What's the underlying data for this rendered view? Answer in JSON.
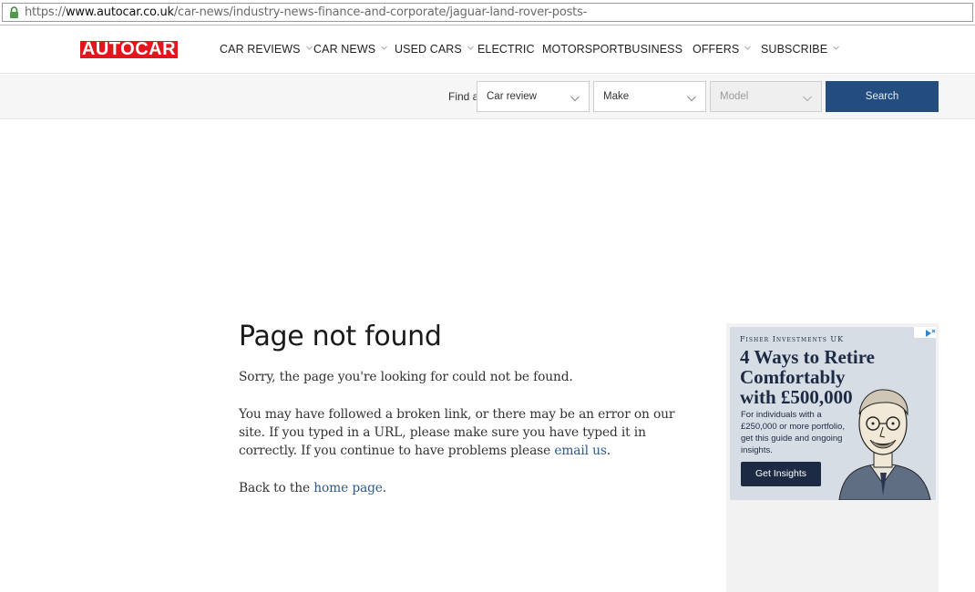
{
  "browser": {
    "url_scheme": "https://",
    "url_domain": "www.autocar.co.uk",
    "url_path": "/car-news/industry-news-finance-and-corporate/jaguar-land-rover-posts-"
  },
  "header": {
    "logo_text": "AUTOCAR",
    "nav": [
      {
        "label": "CAR REVIEWS",
        "has_dropdown": true
      },
      {
        "label": "CAR NEWS",
        "has_dropdown": true
      },
      {
        "label": "USED CARS",
        "has_dropdown": true
      },
      {
        "label": "ELECTRIC",
        "has_dropdown": false
      },
      {
        "label": "MOTORSPORT",
        "has_dropdown": false
      },
      {
        "label": "BUSINESS",
        "has_dropdown": false
      },
      {
        "label": "OFFERS",
        "has_dropdown": true
      },
      {
        "label": "SUBSCRIBE",
        "has_dropdown": true
      }
    ]
  },
  "finder": {
    "label": "Find a",
    "type_select": "Car review",
    "make_select": "Make",
    "model_select": "Model",
    "search_label": "Search"
  },
  "content": {
    "title": "Page not found",
    "sorry": "Sorry, the page you're looking for could not be found.",
    "explain": "You may have followed a broken link,  or there may be an error on our site. If you typed in a URL, please make sure you have typed it in correctly. If you continue to have problems please ",
    "email_link": "email us",
    "explain_end": ".",
    "back_prefix": "Back to the ",
    "home_link": "home page",
    "back_end": "."
  },
  "ad": {
    "brand": "Fisher Investments UK",
    "headline": "4 Ways to Retire Comfortably with £500,000",
    "blurb": "For individuals with a £250,000 or more portfolio, get this guide and ongoing insights.",
    "cta": "Get Insights"
  },
  "colors": {
    "brand_red": "#e3161e",
    "search_blue": "#234d7f",
    "link_blue": "#2b5a8c"
  }
}
